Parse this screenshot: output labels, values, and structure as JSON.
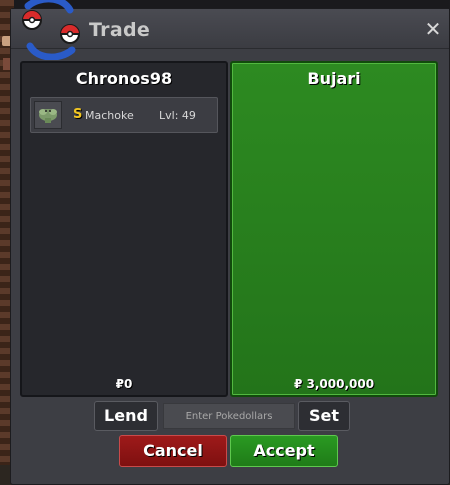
{
  "window": {
    "title": "Trade",
    "close_label": "✕"
  },
  "left_panel": {
    "player": "Chronos98",
    "money": "₽0",
    "items": [
      {
        "badge": "S",
        "name": "Machoke",
        "level": "Lvl: 49",
        "icon": "machoke-sprite-icon"
      }
    ]
  },
  "right_panel": {
    "player": "Bujari",
    "money": "₽ 3,000,000",
    "accent": "#2d8a21"
  },
  "controls": {
    "lend_label": "Lend",
    "input_placeholder": "Enter Pokedollars",
    "set_label": "Set"
  },
  "actions": {
    "cancel_label": "Cancel",
    "accept_label": "Accept",
    "cancel_color": "#9e1a1a",
    "accept_color": "#2a9a22"
  }
}
